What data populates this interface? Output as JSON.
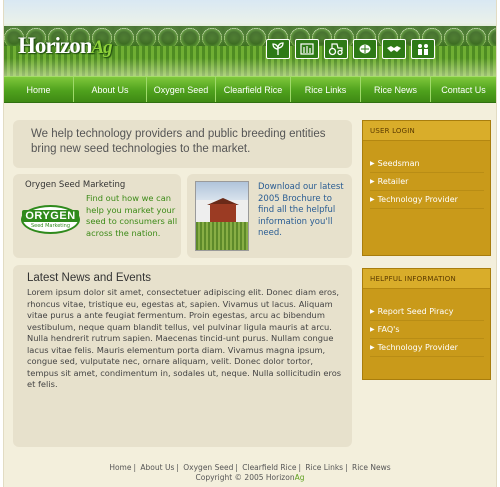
{
  "header": {
    "logo_main": "Horizon",
    "logo_ag": "Ag",
    "icons": [
      "seedling-icon",
      "plant-icon",
      "tractor-icon",
      "grain-icon",
      "handshake-icon",
      "people-icon"
    ]
  },
  "nav": {
    "items": [
      "Home",
      "About Us",
      "Oxygen Seed",
      "Clearfield Rice",
      "Rice Links",
      "Rice News",
      "Contact Us"
    ]
  },
  "intro": {
    "text": "We help technology providers and public breeding entities bring new seed technologies to the market."
  },
  "oxygen": {
    "title": "Orygen Seed Marketing",
    "badge_main": "ORYGEN",
    "badge_sub": "Seed Marketing",
    "body": "Find out how we can help you market your seed to consumers all across the nation."
  },
  "brochure": {
    "body": "Download our latest 2005 Brochure to find all the helpful information you'll need."
  },
  "news": {
    "heading": "Latest News and Events",
    "text": "Lorem ipsum dolor sit amet, consectetuer adipiscing elit. Donec diam eros, rhoncus vitae, tristique eu, egestas at, sapien. Vivamus ut lacus. Aliquam vitae purus a ante feugiat fermentum. Proin egestas, arcu ac bibendum vestibulum, neque quam blandit tellus, vel pulvinar ligula mauris at arcu. Nulla hendrerit rutrum sapien. Maecenas tincid-unt purus. Nullam congue lacus vitae felis. Mauris elementum porta diam. Vivamus magna ipsum, congue sed, vulputate nec, ornare aliquam, velit. Donec dolor tortor, tempus sit amet, condimentum in, sodales ut, neque. Nulla sollicitudin eros et felis."
  },
  "sidebar": {
    "login_title": "USER LOGIN",
    "login_items": [
      "Seedsman",
      "Retailer",
      "Technology Provider"
    ],
    "help_title": "HELPFUL INFORMATION",
    "help_items": [
      "Report Seed Piracy",
      "FAQ's",
      "Technology Provider"
    ]
  },
  "footer": {
    "links": [
      "Home",
      "About Us",
      "Oxygen Seed",
      "Clearfield Rice",
      "Rice Links",
      "Rice News"
    ],
    "copyright": "Copyright © 2005 Horizon",
    "copyright_ag": "Ag"
  },
  "colors": {
    "nav_green": "#4fa11d",
    "sidebar_gold": "#c99a1a",
    "content_beige": "#e7e1cc",
    "page_bg": "#f3efdc",
    "link_blue": "#2a5d93",
    "accent_green": "#3c8a17"
  }
}
